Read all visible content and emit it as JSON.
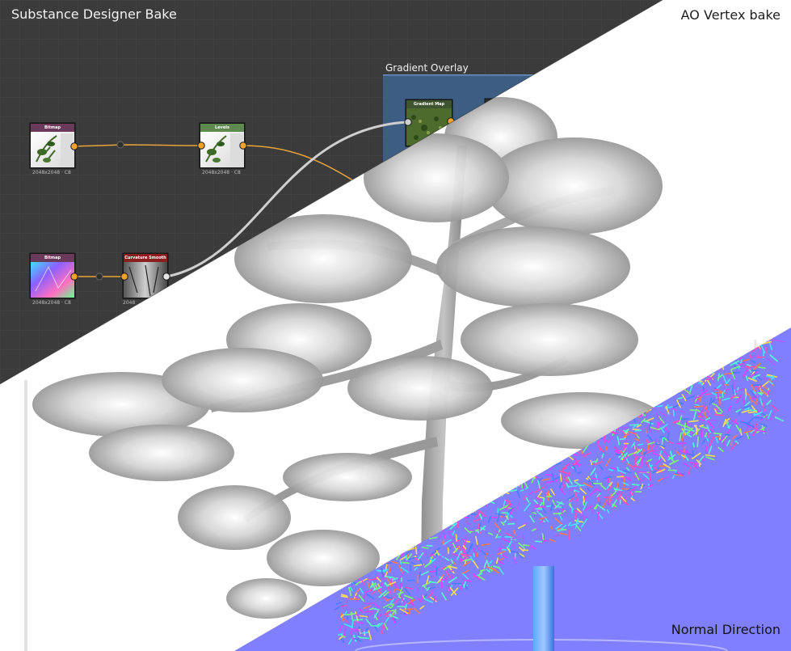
{
  "labels": {
    "designer": "Substance Designer Bake",
    "ao": "AO Vertex bake",
    "normal": "Normal Direction"
  },
  "graph": {
    "frame_title": "Gradient Overlay",
    "nodes": [
      {
        "title": "Bitmap",
        "resolution": "2048x2048 · C8",
        "color": "#6a3a5a"
      },
      {
        "title": "Levels",
        "resolution": "2048x2048 · C8",
        "color": "#5e8a52"
      },
      {
        "title": "Bitmap",
        "resolution": "2048x2048 · C8",
        "color": "#6a3a5a"
      },
      {
        "title": "Curvature Smooth",
        "resolution": "2048",
        "color": "#8a1f1f"
      },
      {
        "title": "Gradient Map",
        "resolution": "",
        "color": "#3e5530"
      }
    ]
  },
  "colors": {
    "graph_bg": "#3b3b3b",
    "grid": "#444444",
    "frame": "#3d5f86",
    "wire": "#e8a33a",
    "ao_bg": "#ffffff",
    "normal_bg": "#7f7fff"
  }
}
